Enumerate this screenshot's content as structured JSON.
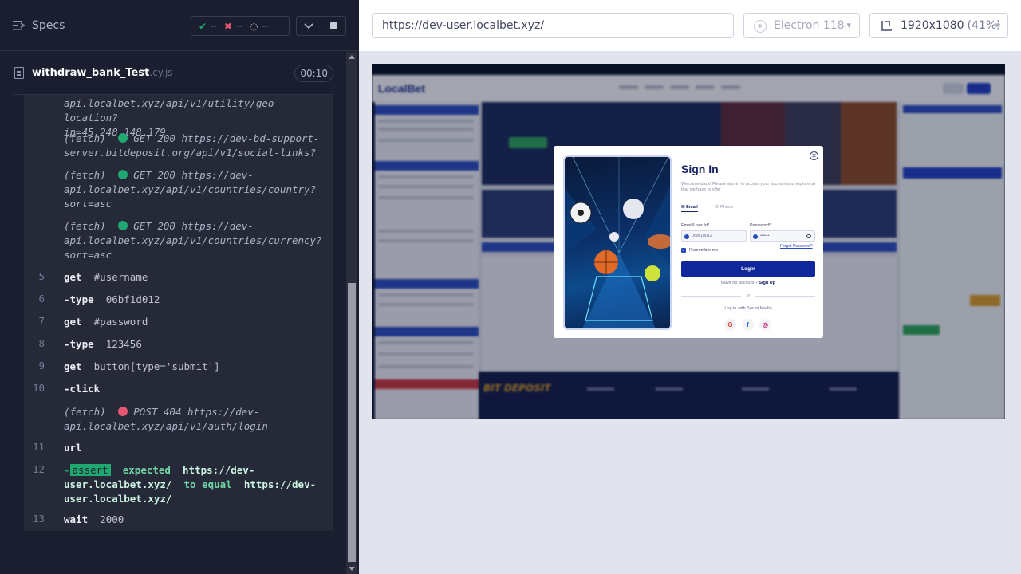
{
  "reporter": {
    "specs_label": "Specs",
    "stats": {
      "passed": {
        "icon": "check-icon",
        "value": "--"
      },
      "failed": {
        "icon": "x-icon",
        "value": "--"
      },
      "pending": {
        "icon": "spinner-icon",
        "value": "--"
      }
    },
    "spec": {
      "name": "withdraw_bank_Test",
      "ext": ".cy.js",
      "duration": "00:10"
    },
    "log": {
      "fetch1_line2": "api.localbet.xyz/api/v1/utility/geo-location?",
      "fetch1_line3": "ip=45.248.148.179",
      "fetch2_prefix": "(fetch)",
      "fetch2_line1": "GET 200 https://dev-bd-support-",
      "fetch2_line2": "server.bitdeposit.org/api/v1/social-links?",
      "fetch3_prefix": "(fetch)",
      "fetch3_line1": "GET 200 https://dev-",
      "fetch3_line2": "api.localbet.xyz/api/v1/countries/country?",
      "fetch3_line3": "sort=asc",
      "fetch4_prefix": "(fetch)",
      "fetch4_line1": "GET 200 https://dev-",
      "fetch4_line2": "api.localbet.xyz/api/v1/countries/currency?",
      "fetch4_line3": "sort=asc",
      "cmd5": {
        "num": "5",
        "name": "get",
        "arg": "#username"
      },
      "cmd6": {
        "num": "6",
        "name": "-type",
        "arg": "06bf1d012"
      },
      "cmd7": {
        "num": "7",
        "name": "get",
        "arg": "#password"
      },
      "cmd8": {
        "num": "8",
        "name": "-type",
        "arg": "123456"
      },
      "cmd9": {
        "num": "9",
        "name": "get",
        "arg": "button[type='submit']"
      },
      "cmd10": {
        "num": "10",
        "name": "-click",
        "arg": ""
      },
      "fetch5_prefix": "(fetch)",
      "fetch5_line1": "POST 404 https://dev-",
      "fetch5_line2": "api.localbet.xyz/api/v1/auth/login",
      "cmd11": {
        "num": "11",
        "name": "url",
        "arg": ""
      },
      "cmd12": {
        "num": "12",
        "dash": "-",
        "tag": "assert",
        "expected": "expected",
        "val1_a": "https://dev-",
        "val1_b": "user.localbet.xyz/",
        "to_equal": "to equal",
        "val2_a": "https://dev-",
        "val2_b": "user.localbet.xyz/"
      },
      "cmd13": {
        "num": "13",
        "name": "wait",
        "arg": "2000"
      }
    }
  },
  "aut": {
    "url": "https://dev-user.localbet.xyz/",
    "browser": "Electron 118",
    "viewport": "1920x1080",
    "viewport_pct": "(41%)",
    "app": {
      "logo": "LocalBet",
      "footer_brand": "BIT DEPOSIT"
    },
    "modal": {
      "title": "Sign In",
      "description": "Welcome back! Please sign in to access your account and explore all that we have to offer",
      "tab_email": "Email",
      "tab_phone": "Phone",
      "email_label": "Email/User Id*",
      "email_value": "06bf1d012",
      "password_label": "Password*",
      "password_value": "••••••",
      "remember": "Remember me",
      "forgot": "Forgot Password?",
      "login_button": "Login",
      "no_account": "Have no account ?",
      "sign_up": "Sign Up",
      "or": "or",
      "social_label": "Log in with Social Media",
      "social": [
        "G",
        "f",
        "◎"
      ]
    }
  }
}
